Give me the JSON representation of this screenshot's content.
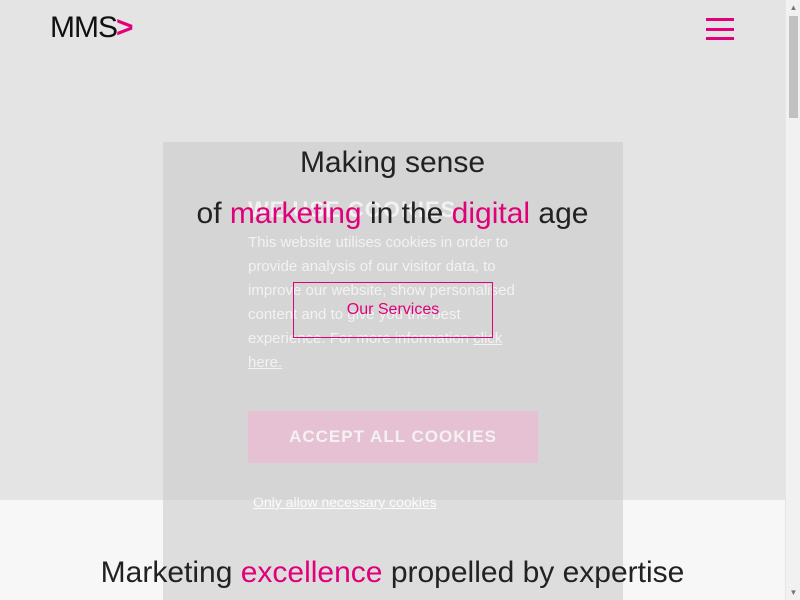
{
  "header": {
    "logo_text": "MMS",
    "logo_chevron": ">",
    "menu_icon": "hamburger-menu-icon"
  },
  "hero": {
    "line1": "Making sense",
    "line2_parts": [
      "of ",
      "marketing",
      " in the ",
      "digital",
      " age"
    ],
    "cta_label": "Our Services"
  },
  "cookie_banner": {
    "title": "WE USE COOKIES",
    "text": "This website utilises cookies in order to provide analysis of our visitor data, to improve our website, show personalised content and to give you the best experience. For more information ",
    "link_text": "click here.",
    "accept_label": "ACCEPT ALL COOKIES",
    "necessary_label": "Only allow necessary cookies"
  },
  "section": {
    "title_parts": [
      "Marketing ",
      "excellence",
      " propelled by expertise"
    ]
  },
  "colors": {
    "accent": "#e0007a",
    "hero_bg": "#e4e4e4"
  }
}
